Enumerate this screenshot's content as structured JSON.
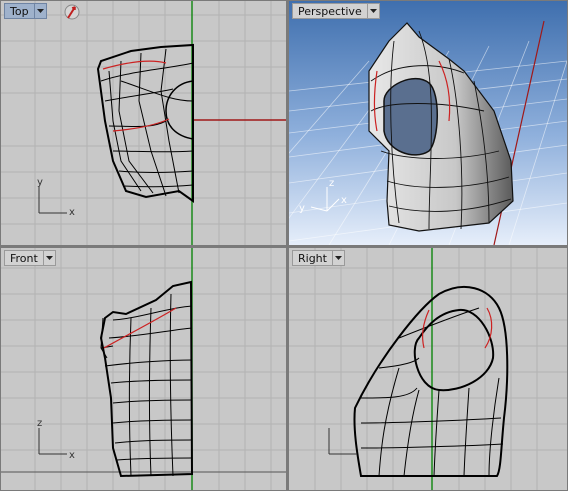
{
  "viewports": {
    "top": {
      "label": "Top",
      "axis_up": "y",
      "axis_right": "x"
    },
    "persp": {
      "label": "Perspective",
      "axis_up": "z",
      "axis_right": "x",
      "axis_left": "y"
    },
    "front": {
      "label": "Front",
      "axis_up": "z",
      "axis_right": "x"
    },
    "right": {
      "label": "Right"
    }
  },
  "colors": {
    "viewport_bg": "#c8c8c8",
    "grid": "#b4b4b4",
    "x_axis": "#a01818",
    "y_axis": "#1a8a1a",
    "persp_sky_top": "#3f6fae",
    "persp_sky_bottom": "#e6eefa",
    "surface_wire": "#000000",
    "highlight_curve": "#cc2222",
    "active_tab": "#9fb2cc"
  },
  "icons": {
    "top_extra": "red-arrow-cursor-icon",
    "dropdown": "chevron-down-icon"
  }
}
